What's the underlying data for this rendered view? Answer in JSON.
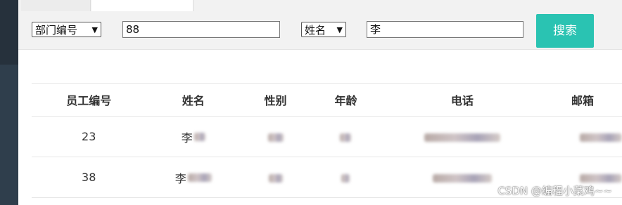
{
  "search": {
    "field1_select": "部门编号",
    "field1_value": "88",
    "field2_select": "姓名",
    "field2_value": "李",
    "button_label": "搜索"
  },
  "table": {
    "headers": [
      "员工编号",
      "姓名",
      "性别",
      "年龄",
      "电话",
      "邮箱"
    ],
    "rows": [
      {
        "id": "23",
        "name_visible": "李"
      },
      {
        "id": "38",
        "name_visible": "李"
      }
    ]
  },
  "watermark": "CSDN @编程小菜鸡~~",
  "colors": {
    "accent": "#2ac3b2",
    "sidebar": "#2f3e4c",
    "toolbar_bg": "#f2f2f2"
  },
  "icons": {
    "select_chevron": "chevron-down-icon"
  }
}
